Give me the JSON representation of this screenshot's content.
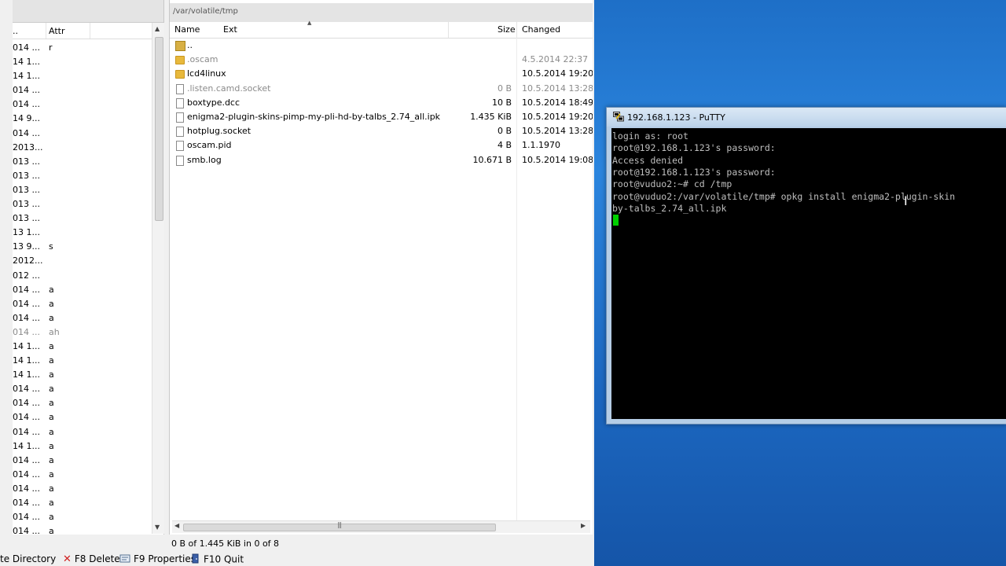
{
  "left_panel": {
    "header": {
      "date_col": "..",
      "attr_col": "Attr"
    },
    "rows": [
      {
        "date": "014 ...",
        "attr": "r"
      },
      {
        "date": "14 1...",
        "attr": ""
      },
      {
        "date": "14 1...",
        "attr": ""
      },
      {
        "date": "014 ...",
        "attr": ""
      },
      {
        "date": "014 ...",
        "attr": ""
      },
      {
        "date": "14 9...",
        "attr": ""
      },
      {
        "date": "014 ...",
        "attr": ""
      },
      {
        "date": "2013...",
        "attr": ""
      },
      {
        "date": "013 ...",
        "attr": ""
      },
      {
        "date": "013 ...",
        "attr": ""
      },
      {
        "date": "013 ...",
        "attr": ""
      },
      {
        "date": "013 ...",
        "attr": ""
      },
      {
        "date": "013 ...",
        "attr": ""
      },
      {
        "date": "13 1...",
        "attr": ""
      },
      {
        "date": "13 9...",
        "attr": "s"
      },
      {
        "date": "2012...",
        "attr": ""
      },
      {
        "date": "012 ...",
        "attr": ""
      },
      {
        "date": "014 ...",
        "attr": "a"
      },
      {
        "date": "014 ...",
        "attr": "a"
      },
      {
        "date": "014 ...",
        "attr": "a"
      },
      {
        "date": "014 ...",
        "attr": "ah",
        "grey": true
      },
      {
        "date": "14 1...",
        "attr": "a"
      },
      {
        "date": "14 1...",
        "attr": "a"
      },
      {
        "date": "14 1...",
        "attr": "a"
      },
      {
        "date": "014 ...",
        "attr": "a"
      },
      {
        "date": "014 ...",
        "attr": "a"
      },
      {
        "date": "014 ...",
        "attr": "a"
      },
      {
        "date": "014 ...",
        "attr": "a"
      },
      {
        "date": "14 1...",
        "attr": "a"
      },
      {
        "date": "014 ...",
        "attr": "a"
      },
      {
        "date": "014 ...",
        "attr": "a"
      },
      {
        "date": "014 ...",
        "attr": "a"
      },
      {
        "date": "014 ...",
        "attr": "a"
      },
      {
        "date": "014 ...",
        "attr": "a"
      },
      {
        "date": "014 ...",
        "attr": "a"
      }
    ]
  },
  "right_panel": {
    "path": "/var/volatile/tmp",
    "header": {
      "name": "Name",
      "ext": "Ext",
      "size": "Size",
      "changed": "Changed"
    },
    "files": [
      {
        "icon": "up",
        "name": "..",
        "size": "",
        "changed": ""
      },
      {
        "icon": "folder",
        "name": ".oscam",
        "size": "",
        "changed": "4.5.2014 22:37",
        "hidden": true
      },
      {
        "icon": "folder",
        "name": "lcd4linux",
        "size": "",
        "changed": "10.5.2014 19:20"
      },
      {
        "icon": "doc",
        "name": ".listen.camd.socket",
        "size": "0 B",
        "changed": "10.5.2014 13:28",
        "hidden": true
      },
      {
        "icon": "doc",
        "name": "boxtype.dcc",
        "size": "10 B",
        "changed": "10.5.2014 18:49"
      },
      {
        "icon": "doc",
        "name": "enigma2-plugin-skins-pimp-my-pli-hd-by-talbs_2.74_all.ipk",
        "size": "1.435 KiB",
        "changed": "10.5.2014 19:20"
      },
      {
        "icon": "doc",
        "name": "hotplug.socket",
        "size": "0 B",
        "changed": "10.5.2014 13:28"
      },
      {
        "icon": "doc",
        "name": "oscam.pid",
        "size": "4 B",
        "changed": "1.1.1970"
      },
      {
        "icon": "doc",
        "name": "smb.log",
        "size": "10.671 B",
        "changed": "10.5.2014 19:08"
      }
    ],
    "status": "0 B of 1.445 KiB in 0 of 8"
  },
  "fkeys": {
    "f7": "te Directory",
    "f8": "F8 Delete",
    "f9": "F9 Properties",
    "f10": "F10 Quit"
  },
  "putty": {
    "title": "192.168.1.123 - PuTTY",
    "lines": [
      "login as: root",
      "root@192.168.1.123's password:",
      "Access denied",
      "root@192.168.1.123's password:",
      "root@vuduo2:~# cd /tmp",
      "root@vuduo2:/var/volatile/tmp# opkg install enigma2-plugin-skin",
      "by-talbs_2.74_all.ipk"
    ]
  },
  "colors": {
    "desktop": "#1e6fc7",
    "terminal_bg": "#000000",
    "terminal_fg": "#bfbfbf",
    "cursor": "#00d000",
    "folder": "#e8b93c"
  }
}
